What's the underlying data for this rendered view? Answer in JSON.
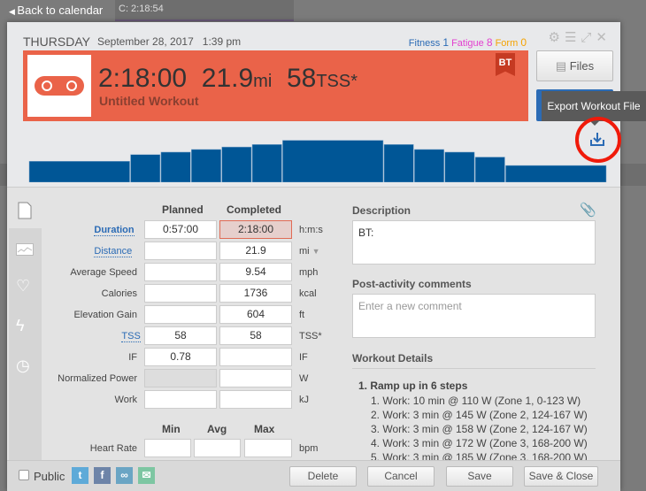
{
  "nav": {
    "back_label": "Back to calendar",
    "calendar_entry": "C: 2:18:54"
  },
  "header": {
    "day": "THURSDAY",
    "date": "September 28, 2017",
    "time": "1:39 pm",
    "fitness_label": "Fitness",
    "fitness": "1",
    "fatigue_label": "Fatigue",
    "fatigue": "8",
    "form_label": "Form",
    "form": "0"
  },
  "summary": {
    "duration": "2:18:00",
    "distance": "21.9",
    "distance_unit": "mi",
    "tss": "58",
    "tss_unit": "TSS*",
    "title": "Untitled Workout",
    "badge": "BT",
    "sport_icon": "bike-chain-icon",
    "color": "#ea6349"
  },
  "buttons": {
    "files": "Files",
    "export_tooltip": "Export Workout File",
    "delete": "Delete",
    "cancel": "Cancel",
    "save": "Save",
    "save_close": "Save & Close"
  },
  "chart_data": {
    "type": "bar",
    "description_units": "W",
    "durations_min": [
      10,
      3,
      3,
      3,
      3,
      3,
      10,
      3,
      3,
      3,
      3,
      10
    ],
    "values": [
      110,
      145,
      158,
      172,
      185,
      198,
      220,
      198,
      172,
      158,
      132,
      88
    ],
    "color": "#005696"
  },
  "form": {
    "planned_header": "Planned",
    "completed_header": "Completed",
    "rows": [
      {
        "label": "Duration",
        "planned": "0:57:00",
        "completed": "2:18:00",
        "unit": "h:m:s"
      },
      {
        "label": "Distance",
        "planned": "",
        "completed": "21.9",
        "unit": "mi"
      },
      {
        "label": "Average Speed",
        "planned": "",
        "completed": "9.54",
        "unit": "mph"
      },
      {
        "label": "Calories",
        "planned": "",
        "completed": "1736",
        "unit": "kcal"
      },
      {
        "label": "Elevation Gain",
        "planned": "",
        "completed": "604",
        "unit": "ft"
      },
      {
        "label": "TSS",
        "planned": "58",
        "completed": "58",
        "unit": "TSS*"
      },
      {
        "label": "IF",
        "planned": "0.78",
        "completed": "",
        "unit": "IF"
      },
      {
        "label": "Normalized Power",
        "planned": "",
        "completed": "",
        "unit": "W"
      },
      {
        "label": "Work",
        "planned": "",
        "completed": "",
        "unit": "kJ"
      }
    ],
    "min_header": "Min",
    "avg_header": "Avg",
    "max_header": "Max",
    "hr": {
      "label": "Heart Rate",
      "unit": "bpm"
    }
  },
  "right": {
    "description_label": "Description",
    "description": "BT:",
    "comments_label": "Post-activity comments",
    "comments_placeholder": "Enter a new comment",
    "details_label": "Workout Details",
    "details_title": "1. Ramp up in 6 steps",
    "steps": [
      "1. Work: 10 min @ 110 W (Zone 1, 0-123 W)",
      "2. Work: 3 min @ 145 W (Zone 2, 124-167 W)",
      "3. Work: 3 min @ 158 W (Zone 2, 124-167 W)",
      "4. Work: 3 min @ 172 W (Zone 3, 168-200 W)",
      "5. Work: 3 min @ 185 W (Zone 3, 168-200 W)"
    ]
  },
  "footer": {
    "public_label": "Public"
  }
}
